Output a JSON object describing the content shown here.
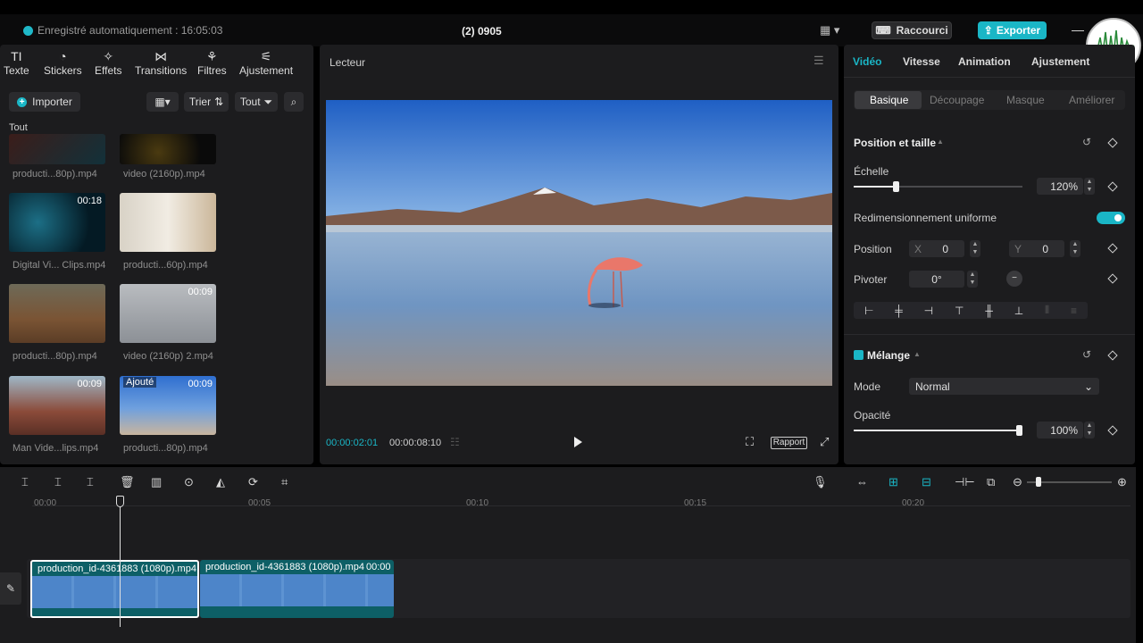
{
  "titlebar": {
    "autosave": "Enregistré automatiquement : 16:05:03",
    "project_title": "(2) 0905",
    "shortcut_label": "Raccourci",
    "export_label": "Exporter"
  },
  "left_toolbar": [
    {
      "label": "Texte",
      "icon": "text-icon"
    },
    {
      "label": "Stickers",
      "icon": "sticker-icon"
    },
    {
      "label": "Effets",
      "icon": "effects-star-icon"
    },
    {
      "label": "Transitions",
      "icon": "transitions-icon"
    },
    {
      "label": "Filtres",
      "icon": "filters-icon"
    },
    {
      "label": "Ajustement",
      "icon": "adjust-sliders-icon"
    }
  ],
  "media": {
    "import_label": "Importer",
    "sort_label": "Trier",
    "filter_label": "Tout",
    "section_label": "Tout",
    "items": [
      {
        "name": "producti...80p).mp4",
        "duration": ""
      },
      {
        "name": "video (2160p).mp4",
        "duration": ""
      },
      {
        "name": "Digital Vi... Clips.mp4",
        "duration": "00:18"
      },
      {
        "name": "producti...60p).mp4",
        "duration": ""
      },
      {
        "name": "producti...80p).mp4",
        "duration": ""
      },
      {
        "name": "video (2160p) 2.mp4",
        "duration": "00:09"
      },
      {
        "name": "Man Vide...lips.mp4",
        "duration": "00:09"
      },
      {
        "name": "producti...80p).mp4",
        "duration": "00:09",
        "tag": "Ajouté"
      }
    ]
  },
  "player": {
    "title": "Lecteur",
    "current_time": "00:00:02:01",
    "total_time": "00:00:08:10",
    "report_label": "Rapport"
  },
  "inspector": {
    "tabs": [
      "Vidéo",
      "Vitesse",
      "Animation",
      "Ajustement"
    ],
    "subtabs": [
      "Basique",
      "Découpage",
      "Masque",
      "Améliorer"
    ],
    "position_section": "Position et taille",
    "scale_label": "Échelle",
    "scale_value": "120%",
    "scale_fraction": 0.25,
    "uniform_label": "Redimensionnement uniforme",
    "position_label": "Position",
    "x_label": "X",
    "x_value": "0",
    "y_label": "Y",
    "y_value": "0",
    "rotate_label": "Pivoter",
    "rotate_value": "0°",
    "blend_section": "Mélange",
    "mode_label": "Mode",
    "mode_value": "Normal",
    "opacity_label": "Opacité",
    "opacity_value": "100%",
    "opacity_fraction": 1.0
  },
  "timeline": {
    "ruler": [
      "00:00",
      "00:05",
      "00:10",
      "00:15",
      "00:20"
    ],
    "clips": [
      {
        "name": "production_id-4361883 (1080p).mp4"
      },
      {
        "name": "production_id-4361883 (1080p).mp4",
        "duration": "00:00"
      }
    ]
  },
  "colors": {
    "accent": "#1ab6c6",
    "panel": "#1c1c1e",
    "background": "#000000"
  }
}
